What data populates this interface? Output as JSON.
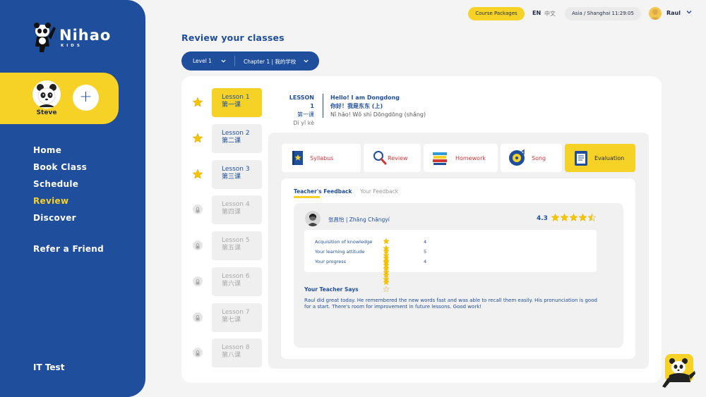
{
  "brand": {
    "name": "Nihao",
    "sub": "KIDS"
  },
  "profile": {
    "name": "Steve",
    "add_label": "+"
  },
  "nav": {
    "items": [
      {
        "label": "Home",
        "active": false
      },
      {
        "label": "Book Class",
        "active": false
      },
      {
        "label": "Schedule",
        "active": false
      },
      {
        "label": "Review",
        "active": true
      },
      {
        "label": "Discover",
        "active": false
      }
    ],
    "refer": "Refer a Friend",
    "it_test": "IT Test"
  },
  "header": {
    "packages": "Course Packages",
    "lang_en": "EN",
    "lang_zh": "中文",
    "timezone": "Asia / Shanghai 11:29:05",
    "user": "Raul"
  },
  "page_title": "Review your classes",
  "selectors": {
    "level": "Level 1",
    "chapter": "Chapter 1 | 我的学校"
  },
  "lessons": [
    {
      "en": "Lesson 1",
      "zh": "第一课",
      "status": "active"
    },
    {
      "en": "Lesson 2",
      "zh": "第二课",
      "status": "done"
    },
    {
      "en": "Lesson 3",
      "zh": "第三课",
      "status": "done"
    },
    {
      "en": "Lesson 4",
      "zh": "第四课",
      "status": "locked"
    },
    {
      "en": "Lesson 5",
      "zh": "第五课",
      "status": "locked"
    },
    {
      "en": "Lesson 6",
      "zh": "第六课",
      "status": "locked"
    },
    {
      "en": "Lesson 7",
      "zh": "第七课",
      "status": "locked"
    },
    {
      "en": "Lesson 8",
      "zh": "第八课",
      "status": "locked"
    }
  ],
  "lesson_header": {
    "label_en": "LESSON 1",
    "label_zh": "第一课",
    "label_pinyin": "Dì yī kè",
    "title_en": "Hello! I am Dongdong",
    "title_zh": "你好！我是东东 (上)",
    "title_pinyin": "Nǐ hǎo! Wǒ shì Dōngdōng (shǎng)"
  },
  "tabs": [
    {
      "label": "Syllabus",
      "icon": "book-icon"
    },
    {
      "label": "Review",
      "icon": "magnifier-icon"
    },
    {
      "label": "Homework",
      "icon": "books-stack-icon"
    },
    {
      "label": "Song",
      "icon": "song-icon"
    },
    {
      "label": "Evaluation",
      "icon": "evaluation-icon",
      "active": true
    }
  ],
  "feedback": {
    "tab_teacher": "Teacher's Feedback",
    "tab_yours": "Your Feedback",
    "teacher_name": "张昌怡 | Zhāng Chāngyí",
    "overall_score": "4.3",
    "overall_stars": 4.5,
    "ratings": [
      {
        "label": "Acquisition of knowledge",
        "stars": 4,
        "score": "4"
      },
      {
        "label": "Your learning attitude",
        "stars": 5,
        "score": "5"
      },
      {
        "label": "Your progress",
        "stars": 4,
        "score": "4"
      }
    ],
    "says_title": "Your Teacher Says",
    "says_text": "Raul did great today. He remembered the new words fast and was able to recall them easily. His pronunciation is good for a start. There's room for improvement in future lessons. Good work!"
  },
  "colors": {
    "primary": "#1f4e9c",
    "accent": "#f6d227",
    "tab_text": "#d03636"
  }
}
